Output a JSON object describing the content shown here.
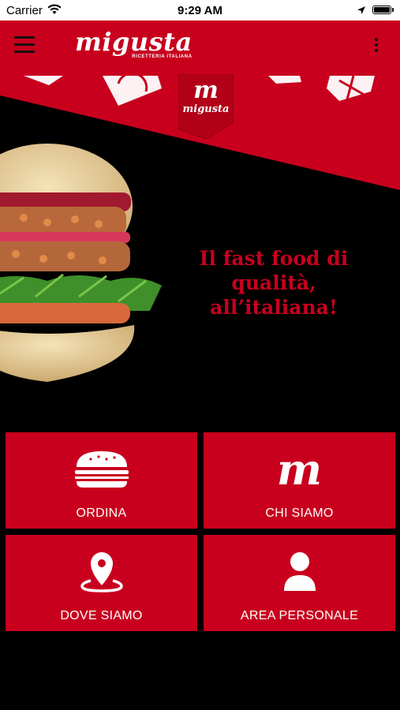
{
  "status_bar": {
    "carrier": "Carrier",
    "time": "9:29 AM"
  },
  "app_bar": {
    "logo_text": "migusta",
    "logo_subtitle": "RICETTERIA ITALIANA",
    "menu_icon": "hamburger-menu-icon",
    "more_icon": "more-vertical-icon"
  },
  "hero": {
    "badge_logo": "m",
    "badge_word": "migusta",
    "tagline": "Il fast food di\nqualità,\nall’italiana!",
    "accent_color": "#c8001e"
  },
  "tiles": [
    {
      "label": "ORDINA",
      "icon": "burger-icon"
    },
    {
      "label": "CHI SIAMO",
      "icon": "migusta-logo-icon"
    },
    {
      "label": "DOVE SIAMO",
      "icon": "location-pin-icon"
    },
    {
      "label": "AREA PERSONALE",
      "icon": "user-icon"
    }
  ],
  "tile_m_glyph": "m"
}
